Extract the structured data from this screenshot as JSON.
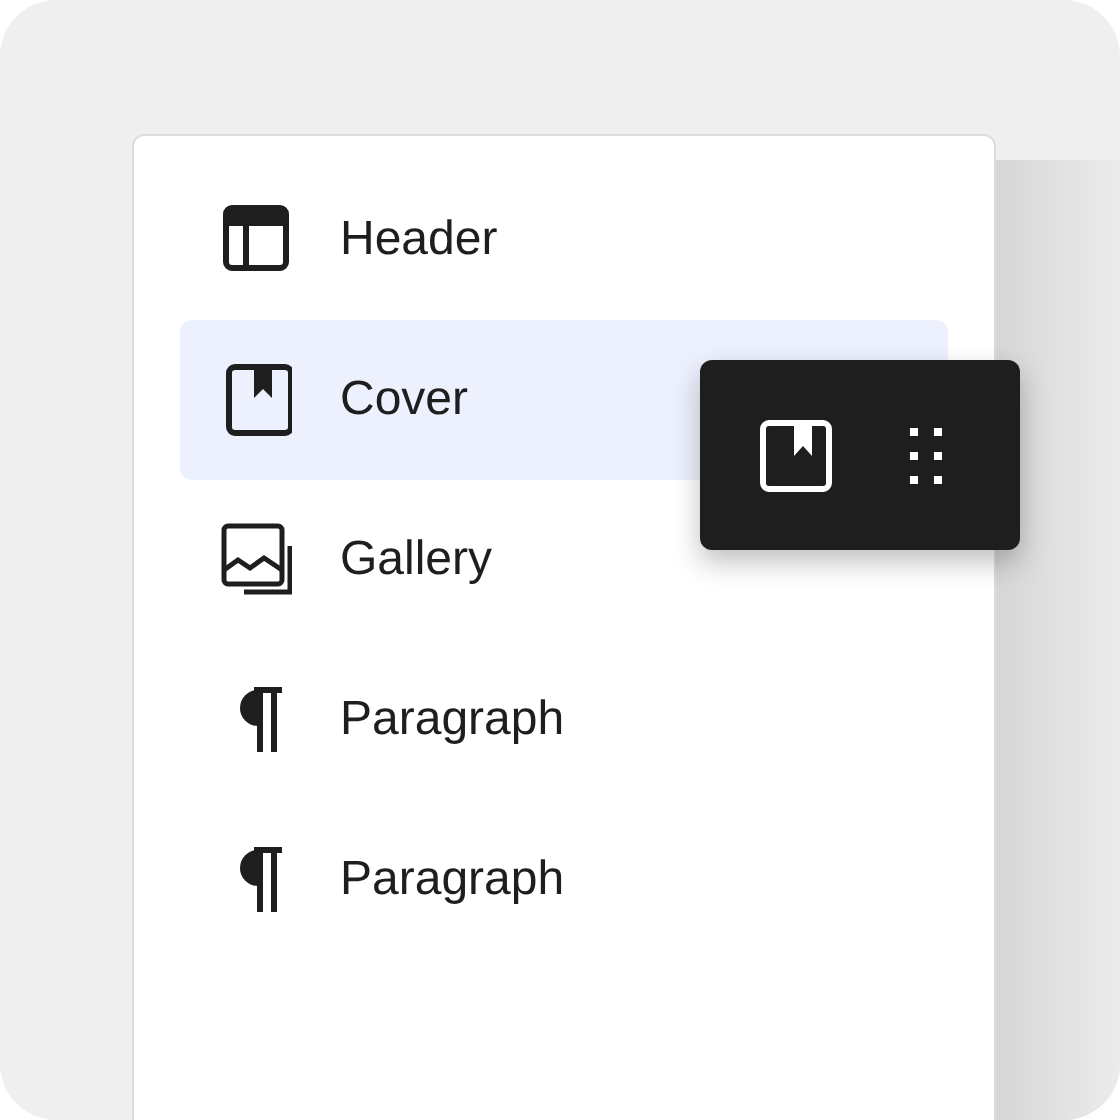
{
  "blocks": [
    {
      "kind": "header",
      "label": "Header",
      "selected": false
    },
    {
      "kind": "cover",
      "label": "Cover",
      "selected": true
    },
    {
      "kind": "gallery",
      "label": "Gallery",
      "selected": false
    },
    {
      "kind": "paragraph",
      "label": "Paragraph",
      "selected": false
    },
    {
      "kind": "paragraph",
      "label": "Paragraph",
      "selected": false
    }
  ]
}
